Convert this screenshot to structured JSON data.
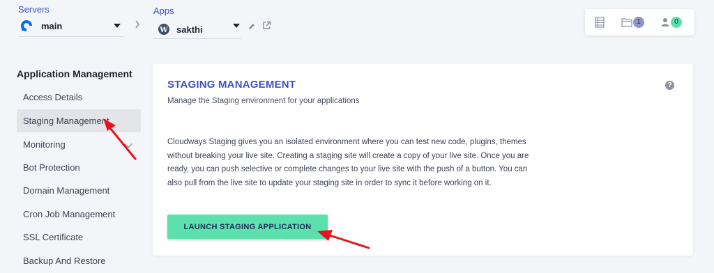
{
  "header": {
    "servers_label": "Servers",
    "server_name": "main",
    "apps_label": "Apps",
    "app_name": "sakthi",
    "folder_count": "1",
    "user_count": "0"
  },
  "sidebar": {
    "title": "Application Management",
    "items": [
      {
        "label": "Access Details"
      },
      {
        "label": "Staging Management"
      },
      {
        "label": "Monitoring"
      },
      {
        "label": "Bot Protection"
      },
      {
        "label": "Domain Management"
      },
      {
        "label": "Cron Job Management"
      },
      {
        "label": "SSL Certificate"
      },
      {
        "label": "Backup And Restore"
      }
    ]
  },
  "main": {
    "title": "STAGING MANAGEMENT",
    "subtitle": "Manage the Staging environment for your applications",
    "description": "Cloudways Staging gives you an isolated environment where you can test new code, plugins, themes without breaking your live site. Creating a staging site will create a copy of your live site. Once you are ready, you can push selective or complete changes to your live site with the push of a button. You can also pull from the live site to update your staging site in order to sync it before working on it.",
    "button_label": "LAUNCH STAGING APPLICATION",
    "help_icon": "?"
  },
  "colors": {
    "accent": "#3b53c7",
    "button": "#5ce0ad",
    "arrow": "#e8141c",
    "folder_badge": "#8e94c9",
    "user_badge": "#5ce0ad"
  }
}
